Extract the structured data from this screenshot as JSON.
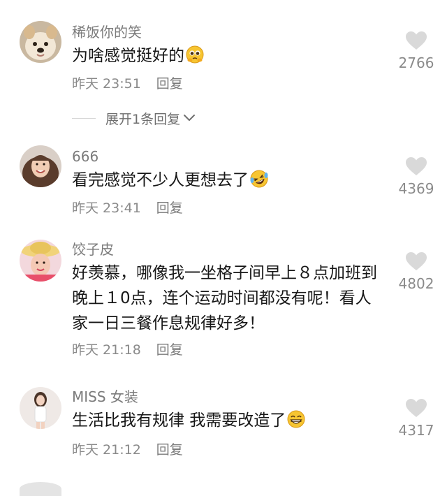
{
  "comments": [
    {
      "username": "稀饭你的笑",
      "text": "为啥感觉挺好的",
      "emoji": "pleading-face-emoji",
      "time": "昨天 23:51",
      "reply_label": "回复",
      "likes": "2766",
      "expand_label": "展开1条回复"
    },
    {
      "username": "666",
      "text": "看完感觉不少人更想去了",
      "emoji": "rolling-laughing-emoji",
      "time": "昨天 23:41",
      "reply_label": "回复",
      "likes": "4369"
    },
    {
      "username": "饺子皮",
      "text": "好羡慕，哪像我一坐格子间早上８点加班到晚上１0点，连个运动时间都没有呢！看人家一日三餐作息规律好多！",
      "time": "昨天 21:18",
      "reply_label": "回复",
      "likes": "4802"
    },
    {
      "username": "MISS 女装",
      "text": "生活比我有规律 我需要改造了",
      "emoji": "grinning-face-emoji",
      "time": "昨天 21:12",
      "reply_label": "回复",
      "likes": "4317"
    }
  ],
  "colors": {
    "username": "#7b7b7b",
    "text": "#171717",
    "meta": "#8a8a8a",
    "heart": "#d9d9d9",
    "emoji_yellow": "#f7c531"
  }
}
